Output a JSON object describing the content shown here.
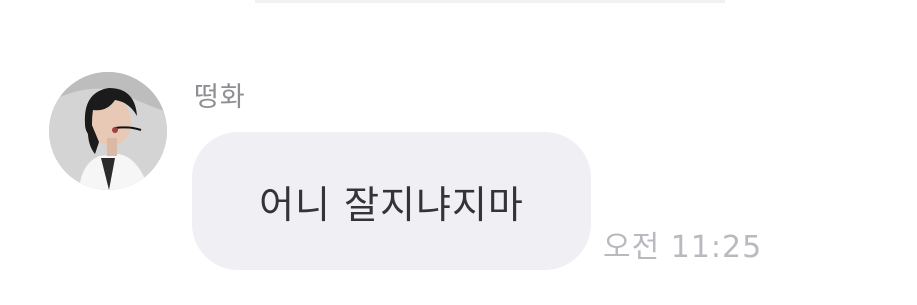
{
  "message": {
    "sender_name": "떵화",
    "text": "어니 잘지냐지마",
    "time": "오전 11:25"
  },
  "avatar": {
    "icon": "profile-photo-icon"
  },
  "colors": {
    "bubble_background": "#f0f0f4",
    "sender_name": "#8e8e93",
    "message_text": "#333338",
    "timestamp": "#b9b9bf"
  }
}
